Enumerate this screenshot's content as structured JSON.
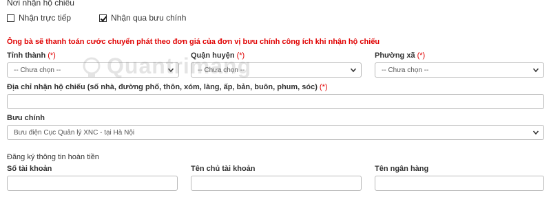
{
  "receive": {
    "title": "Nơi nhận hộ chiếu",
    "options": [
      {
        "label": "Nhận trực tiếp",
        "checked": false
      },
      {
        "label": "Nhận qua bưu chính",
        "checked": true
      }
    ]
  },
  "notice": "Ông bà sẽ thanh toán cước chuyển phát theo đơn giá của đơn vị bưu chính công ích khi nhận hộ chiếu",
  "required_mark": "(*)",
  "address": {
    "province": {
      "label": "Tỉnh thành",
      "value": "-- Chưa chọn --"
    },
    "district": {
      "label": "Quận huyện",
      "value": "-- Chưa chọn --"
    },
    "ward": {
      "label": "Phường xã",
      "value": "-- Chưa chọn --"
    },
    "street": {
      "label": "Địa chỉ nhận hộ chiếu (số nhà, đường phố, thôn, xóm, làng, ấp, bản, buôn, phum, sóc)",
      "value": ""
    }
  },
  "postal": {
    "label": "Bưu chính",
    "value": "Bưu điện Cục Quản lý XNC - tại Hà Nội"
  },
  "refund": {
    "title": "Đăng ký thông tin hoàn tiền",
    "account_number": {
      "label": "Số tài khoản",
      "value": ""
    },
    "account_name": {
      "label": "Tên chủ tài khoản",
      "value": ""
    },
    "bank_name": {
      "label": "Tên ngân hàng",
      "value": ""
    }
  },
  "watermark": "Quantrimang"
}
